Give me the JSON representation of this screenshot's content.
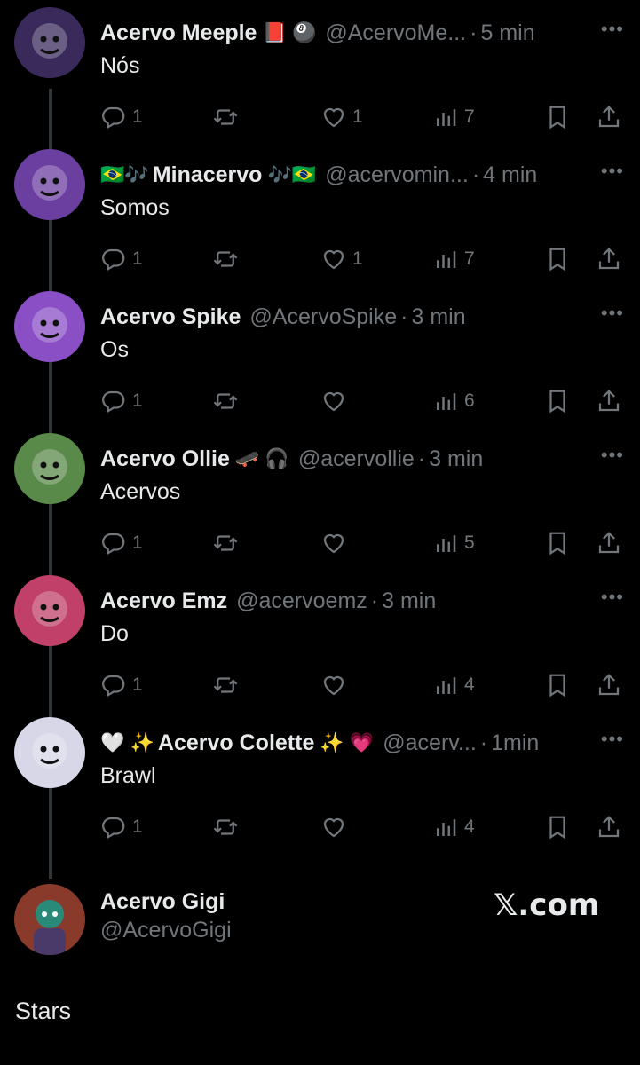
{
  "tweets": [
    {
      "name": "Acervo Meeple",
      "emoji_pre": "",
      "emoji_post": "📕 🎱",
      "handle": "@AcervoMe...",
      "time": "5 min",
      "text": "Nós",
      "replies": "1",
      "likes": "1",
      "views": "7",
      "avatar_color": "#3a2a5c"
    },
    {
      "name": "Minacervo",
      "emoji_pre": "🇧🇷🎶",
      "emoji_post": "🎶🇧🇷",
      "handle": "@acervomin...",
      "time": "4 min",
      "text": "Somos",
      "replies": "1",
      "likes": "1",
      "views": "7",
      "avatar_color": "#6b3fa0"
    },
    {
      "name": "Acervo Spike",
      "emoji_pre": "",
      "emoji_post": "",
      "handle": "@AcervoSpike",
      "time": "3 min",
      "text": "Os",
      "replies": "1",
      "likes": "",
      "views": "6",
      "avatar_color": "#8a4fc4"
    },
    {
      "name": "Acervo Ollie",
      "emoji_pre": "",
      "emoji_post": "🛹 🎧",
      "handle": "@acervollie",
      "time": "3 min",
      "text": "Acervos",
      "replies": "1",
      "likes": "",
      "views": "5",
      "avatar_color": "#5a8a4a"
    },
    {
      "name": "Acervo Emz",
      "emoji_pre": "",
      "emoji_post": "",
      "handle": "@acervoemz",
      "time": "3 min",
      "text": "Do",
      "replies": "1",
      "likes": "",
      "views": "4",
      "avatar_color": "#c0406a"
    },
    {
      "name": "Acervo Colette",
      "emoji_pre": "🤍 ✨",
      "emoji_post": "✨ 💗",
      "handle": "@acerv...",
      "time": "1min",
      "text": "Brawl",
      "replies": "1",
      "likes": "",
      "views": "4",
      "avatar_color": "#d7d7e8"
    }
  ],
  "more_label": "•••",
  "dot": "·",
  "last": {
    "name": "Acervo Gigi",
    "handle": "@AcervoGigi",
    "avatar_color": "#8a3a2a"
  },
  "watermark": "𝕏.com",
  "footer_text": "Stars",
  "colors": {
    "background": "#000000",
    "text": "#e7e9ea",
    "muted": "#71767b",
    "thread_line": "#333639"
  },
  "icons": [
    "reply-icon",
    "retweet-icon",
    "like-icon",
    "views-icon",
    "bookmark-icon",
    "share-icon",
    "more-icon"
  ]
}
